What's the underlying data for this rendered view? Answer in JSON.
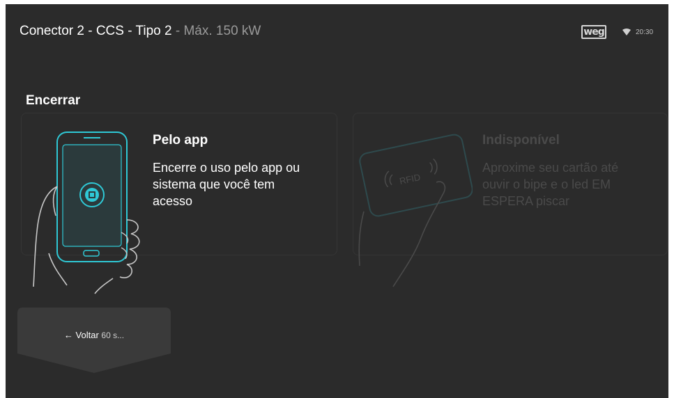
{
  "header": {
    "title_main": "Conector 2 - CCS - Tipo 2",
    "title_suffix": " - Máx. 150 kW",
    "logo_text": "weg",
    "clock": "20:30"
  },
  "section_title": "Encerrar",
  "cards": {
    "app": {
      "title": "Pelo app",
      "description": "Encerre o uso pelo app ou sistema que você tem acesso",
      "accent_color": "#2fc9d6"
    },
    "rfid": {
      "title": "Indisponível",
      "description": "Aproxime seu cartão até ouvir o bipe e o led EM ESPERA piscar",
      "card_text": "RFID"
    }
  },
  "back_button": {
    "arrow": "←",
    "label": "Voltar",
    "countdown": "60 s..."
  },
  "icons": [
    "weg-logo",
    "wifi-icon",
    "phone-hand-icon",
    "rfid-card-icon",
    "arrow-left-icon"
  ]
}
